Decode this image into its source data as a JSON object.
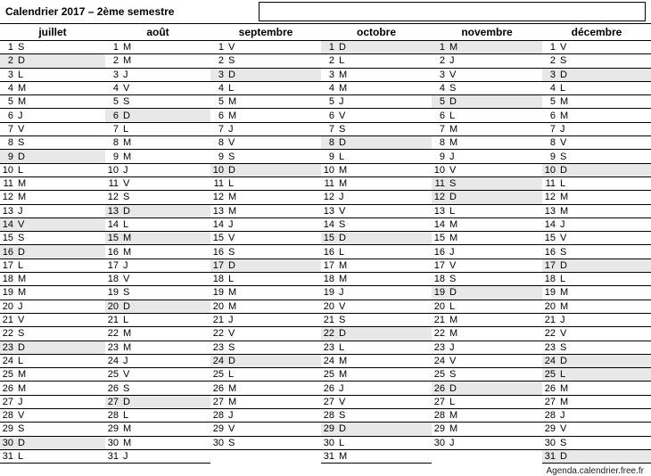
{
  "title": "Calendrier 2017 – 2ème semestre",
  "footer": "Agenda.calendrier.free.fr",
  "months": [
    "juillet",
    "août",
    "septembre",
    "octobre",
    "novembre",
    "décembre"
  ],
  "columns": [
    {
      "days": [
        {
          "n": 1,
          "d": "S",
          "s": false
        },
        {
          "n": 2,
          "d": "D",
          "s": true
        },
        {
          "n": 3,
          "d": "L",
          "s": false
        },
        {
          "n": 4,
          "d": "M",
          "s": false
        },
        {
          "n": 5,
          "d": "M",
          "s": false
        },
        {
          "n": 6,
          "d": "J",
          "s": false
        },
        {
          "n": 7,
          "d": "V",
          "s": false
        },
        {
          "n": 8,
          "d": "S",
          "s": false
        },
        {
          "n": 9,
          "d": "D",
          "s": true
        },
        {
          "n": 10,
          "d": "L",
          "s": false
        },
        {
          "n": 11,
          "d": "M",
          "s": false
        },
        {
          "n": 12,
          "d": "M",
          "s": false
        },
        {
          "n": 13,
          "d": "J",
          "s": false
        },
        {
          "n": 14,
          "d": "V",
          "s": true
        },
        {
          "n": 15,
          "d": "S",
          "s": false
        },
        {
          "n": 16,
          "d": "D",
          "s": true
        },
        {
          "n": 17,
          "d": "L",
          "s": false
        },
        {
          "n": 18,
          "d": "M",
          "s": false
        },
        {
          "n": 19,
          "d": "M",
          "s": false
        },
        {
          "n": 20,
          "d": "J",
          "s": false
        },
        {
          "n": 21,
          "d": "V",
          "s": false
        },
        {
          "n": 22,
          "d": "S",
          "s": false
        },
        {
          "n": 23,
          "d": "D",
          "s": true
        },
        {
          "n": 24,
          "d": "L",
          "s": false
        },
        {
          "n": 25,
          "d": "M",
          "s": false
        },
        {
          "n": 26,
          "d": "M",
          "s": false
        },
        {
          "n": 27,
          "d": "J",
          "s": false
        },
        {
          "n": 28,
          "d": "V",
          "s": false
        },
        {
          "n": 29,
          "d": "S",
          "s": false
        },
        {
          "n": 30,
          "d": "D",
          "s": true
        },
        {
          "n": 31,
          "d": "L",
          "s": false
        }
      ]
    },
    {
      "days": [
        {
          "n": 1,
          "d": "M",
          "s": false
        },
        {
          "n": 2,
          "d": "M",
          "s": false
        },
        {
          "n": 3,
          "d": "J",
          "s": false
        },
        {
          "n": 4,
          "d": "V",
          "s": false
        },
        {
          "n": 5,
          "d": "S",
          "s": false
        },
        {
          "n": 6,
          "d": "D",
          "s": true
        },
        {
          "n": 7,
          "d": "L",
          "s": false
        },
        {
          "n": 8,
          "d": "M",
          "s": false
        },
        {
          "n": 9,
          "d": "M",
          "s": false
        },
        {
          "n": 10,
          "d": "J",
          "s": false
        },
        {
          "n": 11,
          "d": "V",
          "s": false
        },
        {
          "n": 12,
          "d": "S",
          "s": false
        },
        {
          "n": 13,
          "d": "D",
          "s": true
        },
        {
          "n": 14,
          "d": "L",
          "s": false
        },
        {
          "n": 15,
          "d": "M",
          "s": true
        },
        {
          "n": 16,
          "d": "M",
          "s": false
        },
        {
          "n": 17,
          "d": "J",
          "s": false
        },
        {
          "n": 18,
          "d": "V",
          "s": false
        },
        {
          "n": 19,
          "d": "S",
          "s": false
        },
        {
          "n": 20,
          "d": "D",
          "s": true
        },
        {
          "n": 21,
          "d": "L",
          "s": false
        },
        {
          "n": 22,
          "d": "M",
          "s": false
        },
        {
          "n": 23,
          "d": "M",
          "s": false
        },
        {
          "n": 24,
          "d": "J",
          "s": false
        },
        {
          "n": 25,
          "d": "V",
          "s": false
        },
        {
          "n": 26,
          "d": "S",
          "s": false
        },
        {
          "n": 27,
          "d": "D",
          "s": true
        },
        {
          "n": 28,
          "d": "L",
          "s": false
        },
        {
          "n": 29,
          "d": "M",
          "s": false
        },
        {
          "n": 30,
          "d": "M",
          "s": false
        },
        {
          "n": 31,
          "d": "J",
          "s": false
        }
      ]
    },
    {
      "days": [
        {
          "n": 1,
          "d": "V",
          "s": false
        },
        {
          "n": 2,
          "d": "S",
          "s": false
        },
        {
          "n": 3,
          "d": "D",
          "s": true
        },
        {
          "n": 4,
          "d": "L",
          "s": false
        },
        {
          "n": 5,
          "d": "M",
          "s": false
        },
        {
          "n": 6,
          "d": "M",
          "s": false
        },
        {
          "n": 7,
          "d": "J",
          "s": false
        },
        {
          "n": 8,
          "d": "V",
          "s": false
        },
        {
          "n": 9,
          "d": "S",
          "s": false
        },
        {
          "n": 10,
          "d": "D",
          "s": true
        },
        {
          "n": 11,
          "d": "L",
          "s": false
        },
        {
          "n": 12,
          "d": "M",
          "s": false
        },
        {
          "n": 13,
          "d": "M",
          "s": false
        },
        {
          "n": 14,
          "d": "J",
          "s": false
        },
        {
          "n": 15,
          "d": "V",
          "s": false
        },
        {
          "n": 16,
          "d": "S",
          "s": false
        },
        {
          "n": 17,
          "d": "D",
          "s": true
        },
        {
          "n": 18,
          "d": "L",
          "s": false
        },
        {
          "n": 19,
          "d": "M",
          "s": false
        },
        {
          "n": 20,
          "d": "M",
          "s": false
        },
        {
          "n": 21,
          "d": "J",
          "s": false
        },
        {
          "n": 22,
          "d": "V",
          "s": false
        },
        {
          "n": 23,
          "d": "S",
          "s": false
        },
        {
          "n": 24,
          "d": "D",
          "s": true
        },
        {
          "n": 25,
          "d": "L",
          "s": false
        },
        {
          "n": 26,
          "d": "M",
          "s": false
        },
        {
          "n": 27,
          "d": "M",
          "s": false
        },
        {
          "n": 28,
          "d": "J",
          "s": false
        },
        {
          "n": 29,
          "d": "V",
          "s": false
        },
        {
          "n": 30,
          "d": "S",
          "s": false
        }
      ]
    },
    {
      "days": [
        {
          "n": 1,
          "d": "D",
          "s": true
        },
        {
          "n": 2,
          "d": "L",
          "s": false
        },
        {
          "n": 3,
          "d": "M",
          "s": false
        },
        {
          "n": 4,
          "d": "M",
          "s": false
        },
        {
          "n": 5,
          "d": "J",
          "s": false
        },
        {
          "n": 6,
          "d": "V",
          "s": false
        },
        {
          "n": 7,
          "d": "S",
          "s": false
        },
        {
          "n": 8,
          "d": "D",
          "s": true
        },
        {
          "n": 9,
          "d": "L",
          "s": false
        },
        {
          "n": 10,
          "d": "M",
          "s": false
        },
        {
          "n": 11,
          "d": "M",
          "s": false
        },
        {
          "n": 12,
          "d": "J",
          "s": false
        },
        {
          "n": 13,
          "d": "V",
          "s": false
        },
        {
          "n": 14,
          "d": "S",
          "s": false
        },
        {
          "n": 15,
          "d": "D",
          "s": true
        },
        {
          "n": 16,
          "d": "L",
          "s": false
        },
        {
          "n": 17,
          "d": "M",
          "s": false
        },
        {
          "n": 18,
          "d": "M",
          "s": false
        },
        {
          "n": 19,
          "d": "J",
          "s": false
        },
        {
          "n": 20,
          "d": "V",
          "s": false
        },
        {
          "n": 21,
          "d": "S",
          "s": false
        },
        {
          "n": 22,
          "d": "D",
          "s": true
        },
        {
          "n": 23,
          "d": "L",
          "s": false
        },
        {
          "n": 24,
          "d": "M",
          "s": false
        },
        {
          "n": 25,
          "d": "M",
          "s": false
        },
        {
          "n": 26,
          "d": "J",
          "s": false
        },
        {
          "n": 27,
          "d": "V",
          "s": false
        },
        {
          "n": 28,
          "d": "S",
          "s": false
        },
        {
          "n": 29,
          "d": "D",
          "s": true
        },
        {
          "n": 30,
          "d": "L",
          "s": false
        },
        {
          "n": 31,
          "d": "M",
          "s": false
        }
      ]
    },
    {
      "days": [
        {
          "n": 1,
          "d": "M",
          "s": true
        },
        {
          "n": 2,
          "d": "J",
          "s": false
        },
        {
          "n": 3,
          "d": "V",
          "s": false
        },
        {
          "n": 4,
          "d": "S",
          "s": false
        },
        {
          "n": 5,
          "d": "D",
          "s": true
        },
        {
          "n": 6,
          "d": "L",
          "s": false
        },
        {
          "n": 7,
          "d": "M",
          "s": false
        },
        {
          "n": 8,
          "d": "M",
          "s": false
        },
        {
          "n": 9,
          "d": "J",
          "s": false
        },
        {
          "n": 10,
          "d": "V",
          "s": false
        },
        {
          "n": 11,
          "d": "S",
          "s": true
        },
        {
          "n": 12,
          "d": "D",
          "s": true
        },
        {
          "n": 13,
          "d": "L",
          "s": false
        },
        {
          "n": 14,
          "d": "M",
          "s": false
        },
        {
          "n": 15,
          "d": "M",
          "s": false
        },
        {
          "n": 16,
          "d": "J",
          "s": false
        },
        {
          "n": 17,
          "d": "V",
          "s": false
        },
        {
          "n": 18,
          "d": "S",
          "s": false
        },
        {
          "n": 19,
          "d": "D",
          "s": true
        },
        {
          "n": 20,
          "d": "L",
          "s": false
        },
        {
          "n": 21,
          "d": "M",
          "s": false
        },
        {
          "n": 22,
          "d": "M",
          "s": false
        },
        {
          "n": 23,
          "d": "J",
          "s": false
        },
        {
          "n": 24,
          "d": "V",
          "s": false
        },
        {
          "n": 25,
          "d": "S",
          "s": false
        },
        {
          "n": 26,
          "d": "D",
          "s": true
        },
        {
          "n": 27,
          "d": "L",
          "s": false
        },
        {
          "n": 28,
          "d": "M",
          "s": false
        },
        {
          "n": 29,
          "d": "M",
          "s": false
        },
        {
          "n": 30,
          "d": "J",
          "s": false
        }
      ]
    },
    {
      "days": [
        {
          "n": 1,
          "d": "V",
          "s": false
        },
        {
          "n": 2,
          "d": "S",
          "s": false
        },
        {
          "n": 3,
          "d": "D",
          "s": true
        },
        {
          "n": 4,
          "d": "L",
          "s": false
        },
        {
          "n": 5,
          "d": "M",
          "s": false
        },
        {
          "n": 6,
          "d": "M",
          "s": false
        },
        {
          "n": 7,
          "d": "J",
          "s": false
        },
        {
          "n": 8,
          "d": "V",
          "s": false
        },
        {
          "n": 9,
          "d": "S",
          "s": false
        },
        {
          "n": 10,
          "d": "D",
          "s": true
        },
        {
          "n": 11,
          "d": "L",
          "s": false
        },
        {
          "n": 12,
          "d": "M",
          "s": false
        },
        {
          "n": 13,
          "d": "M",
          "s": false
        },
        {
          "n": 14,
          "d": "J",
          "s": false
        },
        {
          "n": 15,
          "d": "V",
          "s": false
        },
        {
          "n": 16,
          "d": "S",
          "s": false
        },
        {
          "n": 17,
          "d": "D",
          "s": true
        },
        {
          "n": 18,
          "d": "L",
          "s": false
        },
        {
          "n": 19,
          "d": "M",
          "s": false
        },
        {
          "n": 20,
          "d": "M",
          "s": false
        },
        {
          "n": 21,
          "d": "J",
          "s": false
        },
        {
          "n": 22,
          "d": "V",
          "s": false
        },
        {
          "n": 23,
          "d": "S",
          "s": false
        },
        {
          "n": 24,
          "d": "D",
          "s": true
        },
        {
          "n": 25,
          "d": "L",
          "s": true
        },
        {
          "n": 26,
          "d": "M",
          "s": false
        },
        {
          "n": 27,
          "d": "M",
          "s": false
        },
        {
          "n": 28,
          "d": "J",
          "s": false
        },
        {
          "n": 29,
          "d": "V",
          "s": false
        },
        {
          "n": 30,
          "d": "S",
          "s": false
        },
        {
          "n": 31,
          "d": "D",
          "s": true
        }
      ]
    }
  ]
}
